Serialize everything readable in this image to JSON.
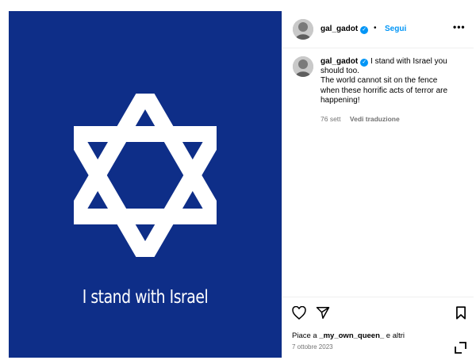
{
  "post": {
    "image_caption": "I stand with Israel",
    "header": {
      "username": "gal_gadot",
      "verified_glyph": "✓",
      "separator": "•",
      "follow_label": "Segui",
      "more_label": "•••"
    },
    "comment": {
      "username": "gal_gadot",
      "lines": [
        " I stand with Israel you",
        "should too.",
        "The world cannot sit on the fence",
        "when these horrific acts of terror are",
        "happening!"
      ],
      "time": "76 sett",
      "translate_label": "Vedi traduzione"
    },
    "actions": {
      "like_icon": "heart-icon",
      "share_icon": "paper-plane-icon",
      "save_icon": "bookmark-icon"
    },
    "likes": {
      "prefix": "Piace a ",
      "user": "_my_own_queen_",
      "suffix": " e altri"
    },
    "date": "7 ottobre 2023"
  },
  "colors": {
    "flag_blue": "#0e2e88",
    "link_blue": "#0095f6",
    "muted": "#737373"
  }
}
